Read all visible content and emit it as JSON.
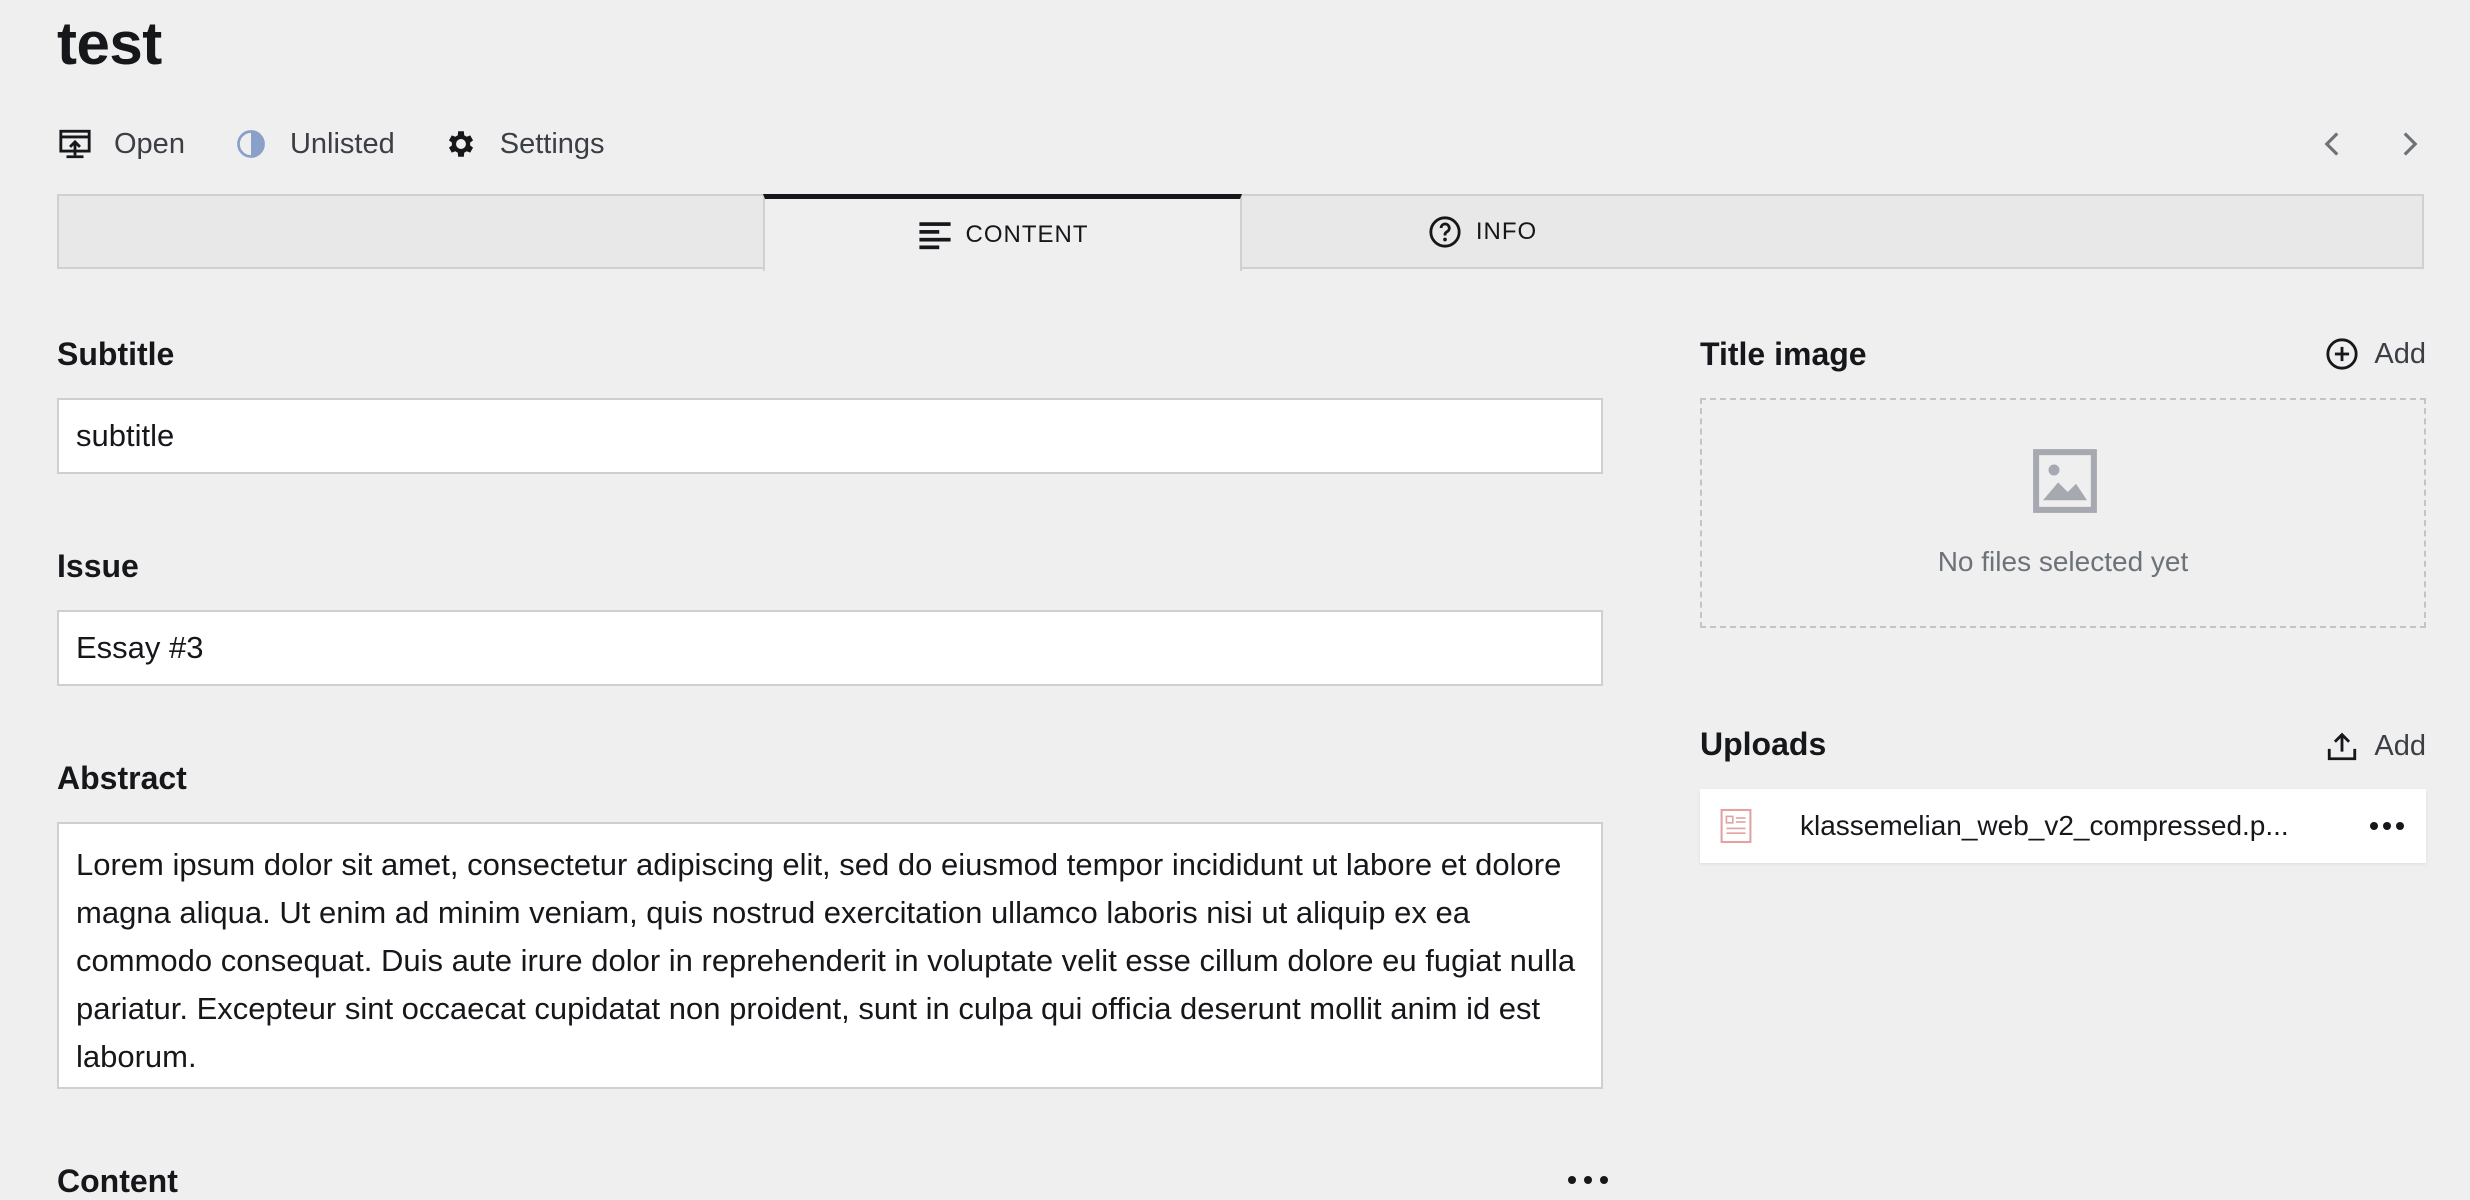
{
  "page": {
    "title": "test"
  },
  "header": {
    "actions": [
      {
        "label": "Open",
        "icon": "open-icon"
      },
      {
        "label": "Unlisted",
        "icon": "status-unlisted-icon"
      },
      {
        "label": "Settings",
        "icon": "gear-icon"
      }
    ],
    "pager": {
      "prev_icon": "chevron-left-icon",
      "next_icon": "chevron-right-icon"
    }
  },
  "tabs": [
    {
      "label": "CONTENT",
      "icon": "text-lines-icon",
      "active": true
    },
    {
      "label": "INFO",
      "icon": "question-circle-icon",
      "active": false
    }
  ],
  "fields": {
    "subtitle": {
      "label": "Subtitle",
      "value": "subtitle"
    },
    "issue": {
      "label": "Issue",
      "value": "Essay #3"
    },
    "abstract": {
      "label": "Abstract",
      "value": "Lorem ipsum dolor sit amet, consectetur adipiscing elit, sed do eiusmod tempor incididunt ut labore et dolore magna aliqua. Ut enim ad minim veniam, quis nostrud exercitation ullamco laboris nisi ut aliquip ex ea commodo consequat. Duis aute irure dolor in reprehenderit in voluptate velit esse cillum dolore eu fugiat nulla pariatur. Excepteur sint occaecat cupidatat non proident, sunt in culpa qui officia deserunt mollit anim id est laborum."
    },
    "content": {
      "label": "Content"
    }
  },
  "title_image": {
    "label": "Title image",
    "add_label": "Add",
    "empty_text": "No files selected yet"
  },
  "uploads": {
    "label": "Uploads",
    "add_label": "Add",
    "items": [
      {
        "name": "klassemelian_web_v2_compressed.p...",
        "icon": "document-icon"
      }
    ]
  },
  "colors": {
    "background": "#efefef",
    "text": "#16171a",
    "unlisted_status": "#8aa0c8",
    "file_icon": "#e3a2a2"
  }
}
